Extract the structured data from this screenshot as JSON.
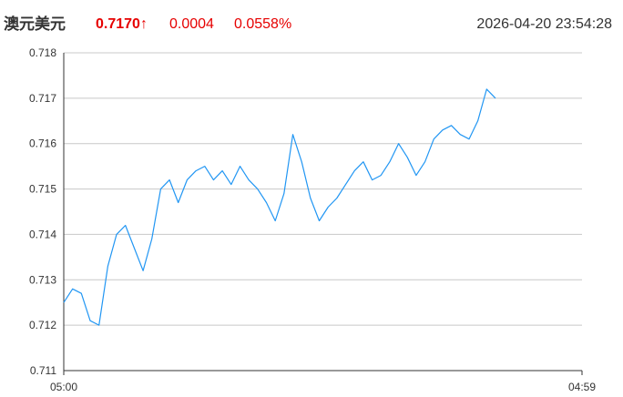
{
  "header": {
    "symbol": "澳元美元",
    "price": "0.7170↑",
    "change": "0.0004",
    "change_pct": "0.0558%",
    "datetime": "2026-04-20 23:54:28"
  },
  "colors": {
    "up": "#e60000",
    "line": "#2196f3",
    "grid": "#c8c8c8",
    "axis": "#333333"
  },
  "chart_data": {
    "type": "line",
    "title": "",
    "xlabel": "",
    "ylabel": "",
    "ylim": [
      0.711,
      0.718
    ],
    "yticks": [
      "0.718",
      "0.717",
      "0.716",
      "0.715",
      "0.714",
      "0.713",
      "0.712",
      "0.711"
    ],
    "xticks": [
      "05:00",
      "04:59"
    ],
    "grid": "horizontal",
    "series": [
      {
        "x": [
          0.0,
          1.7,
          3.4,
          5.1,
          6.8,
          8.5,
          10.2,
          11.9,
          13.6,
          15.3,
          17.0,
          18.7,
          20.4,
          22.1,
          23.8,
          25.5,
          27.2,
          28.9,
          30.6,
          32.3,
          34.0,
          35.7,
          37.4,
          39.1,
          40.8,
          42.5,
          44.2,
          45.9,
          47.6,
          49.3,
          51.0,
          52.7,
          54.4,
          56.1,
          57.8,
          59.5,
          61.2,
          62.9,
          64.6,
          66.3,
          68.0,
          69.7,
          71.4,
          73.1,
          74.8,
          76.5,
          78.2,
          79.9,
          81.6,
          83.3
        ],
        "values": [
          0.7125,
          0.7128,
          0.7127,
          0.7121,
          0.712,
          0.7133,
          0.714,
          0.7142,
          0.7137,
          0.7132,
          0.7139,
          0.715,
          0.7152,
          0.7147,
          0.7152,
          0.7154,
          0.7155,
          0.7152,
          0.7154,
          0.7151,
          0.7155,
          0.7152,
          0.715,
          0.7147,
          0.7143,
          0.7149,
          0.7162,
          0.7156,
          0.7148,
          0.7143,
          0.7146,
          0.7148,
          0.7151,
          0.7154,
          0.7156,
          0.7152,
          0.7153,
          0.7156,
          0.716,
          0.7157,
          0.7153,
          0.7156,
          0.7161,
          0.7163,
          0.7164,
          0.7162,
          0.7161,
          0.7165,
          0.7172,
          0.717
        ]
      }
    ]
  }
}
